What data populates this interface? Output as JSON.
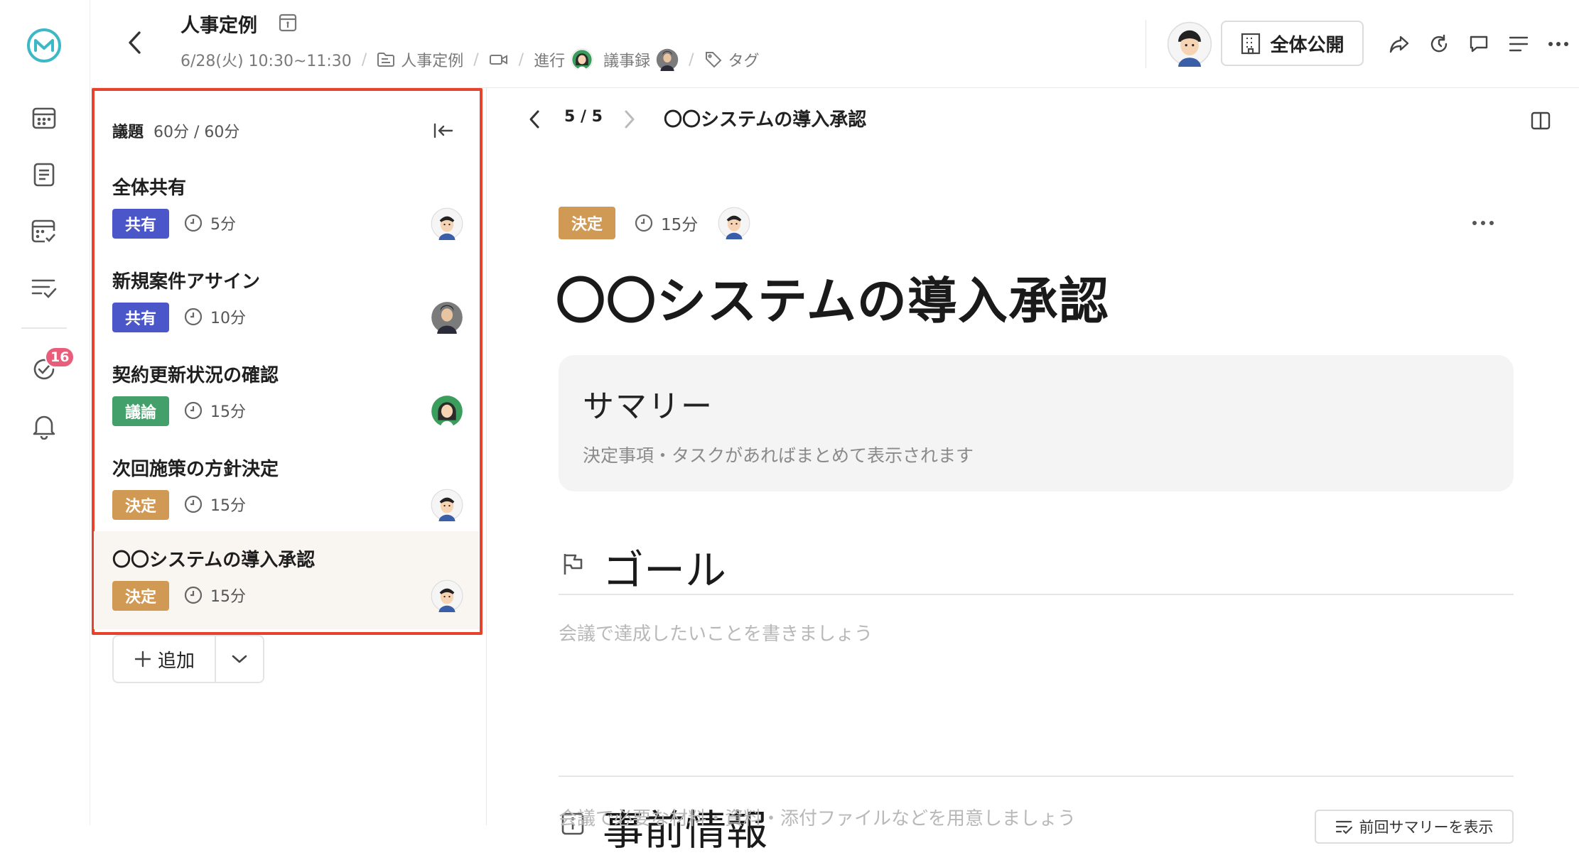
{
  "header": {
    "title": "人事定例",
    "datetime": "6/28(火) 10:30~11:30",
    "folder": "人事定例",
    "facilitator_label": "進行",
    "minutes_label": "議事録",
    "tag_label": "タグ",
    "publish_label": "全体公開"
  },
  "rail": {
    "badge_count": "16"
  },
  "agenda": {
    "label": "議題",
    "duration": "60分 / 60分",
    "items": [
      {
        "title": "全体共有",
        "tag": "共有",
        "tag_color": "#4b57c8",
        "time": "5分"
      },
      {
        "title": "新規案件アサイン",
        "tag": "共有",
        "tag_color": "#4b57c8",
        "time": "10分"
      },
      {
        "title": "契約更新状況の確認",
        "tag": "議論",
        "tag_color": "#44a06b",
        "time": "15分"
      },
      {
        "title": "次回施策の方針決定",
        "tag": "決定",
        "tag_color": "#d09a54",
        "time": "15分"
      },
      {
        "title": "〇〇システムの導入承認",
        "tag": "決定",
        "tag_color": "#d09a54",
        "time": "15分",
        "active": true
      }
    ],
    "add_label": "追加"
  },
  "main": {
    "pager": "5 / 5",
    "topbar_title": "〇〇システムの導入承認",
    "tag": "決定",
    "time": "15分",
    "title": "〇〇システムの導入承認",
    "summary": {
      "title": "サマリー",
      "description": "決定事項・タスクがあればまとめて表示されます"
    },
    "goal": {
      "title": "ゴール",
      "placeholder": "会議で達成したいことを書きましょう"
    },
    "preinfo": {
      "title": "事前情報",
      "placeholder": "会議で必要な材料・資料・添付ファイルなどを用意しましょう",
      "prev_summary_button": "前回サマリーを表示"
    }
  },
  "colors": {
    "accent": "#3cb8c6",
    "highlight_border": "#e5432d",
    "badge": "#e85d7a",
    "tag_share": "#4b57c8",
    "tag_discuss": "#44a06b",
    "tag_decide": "#d09a54"
  }
}
